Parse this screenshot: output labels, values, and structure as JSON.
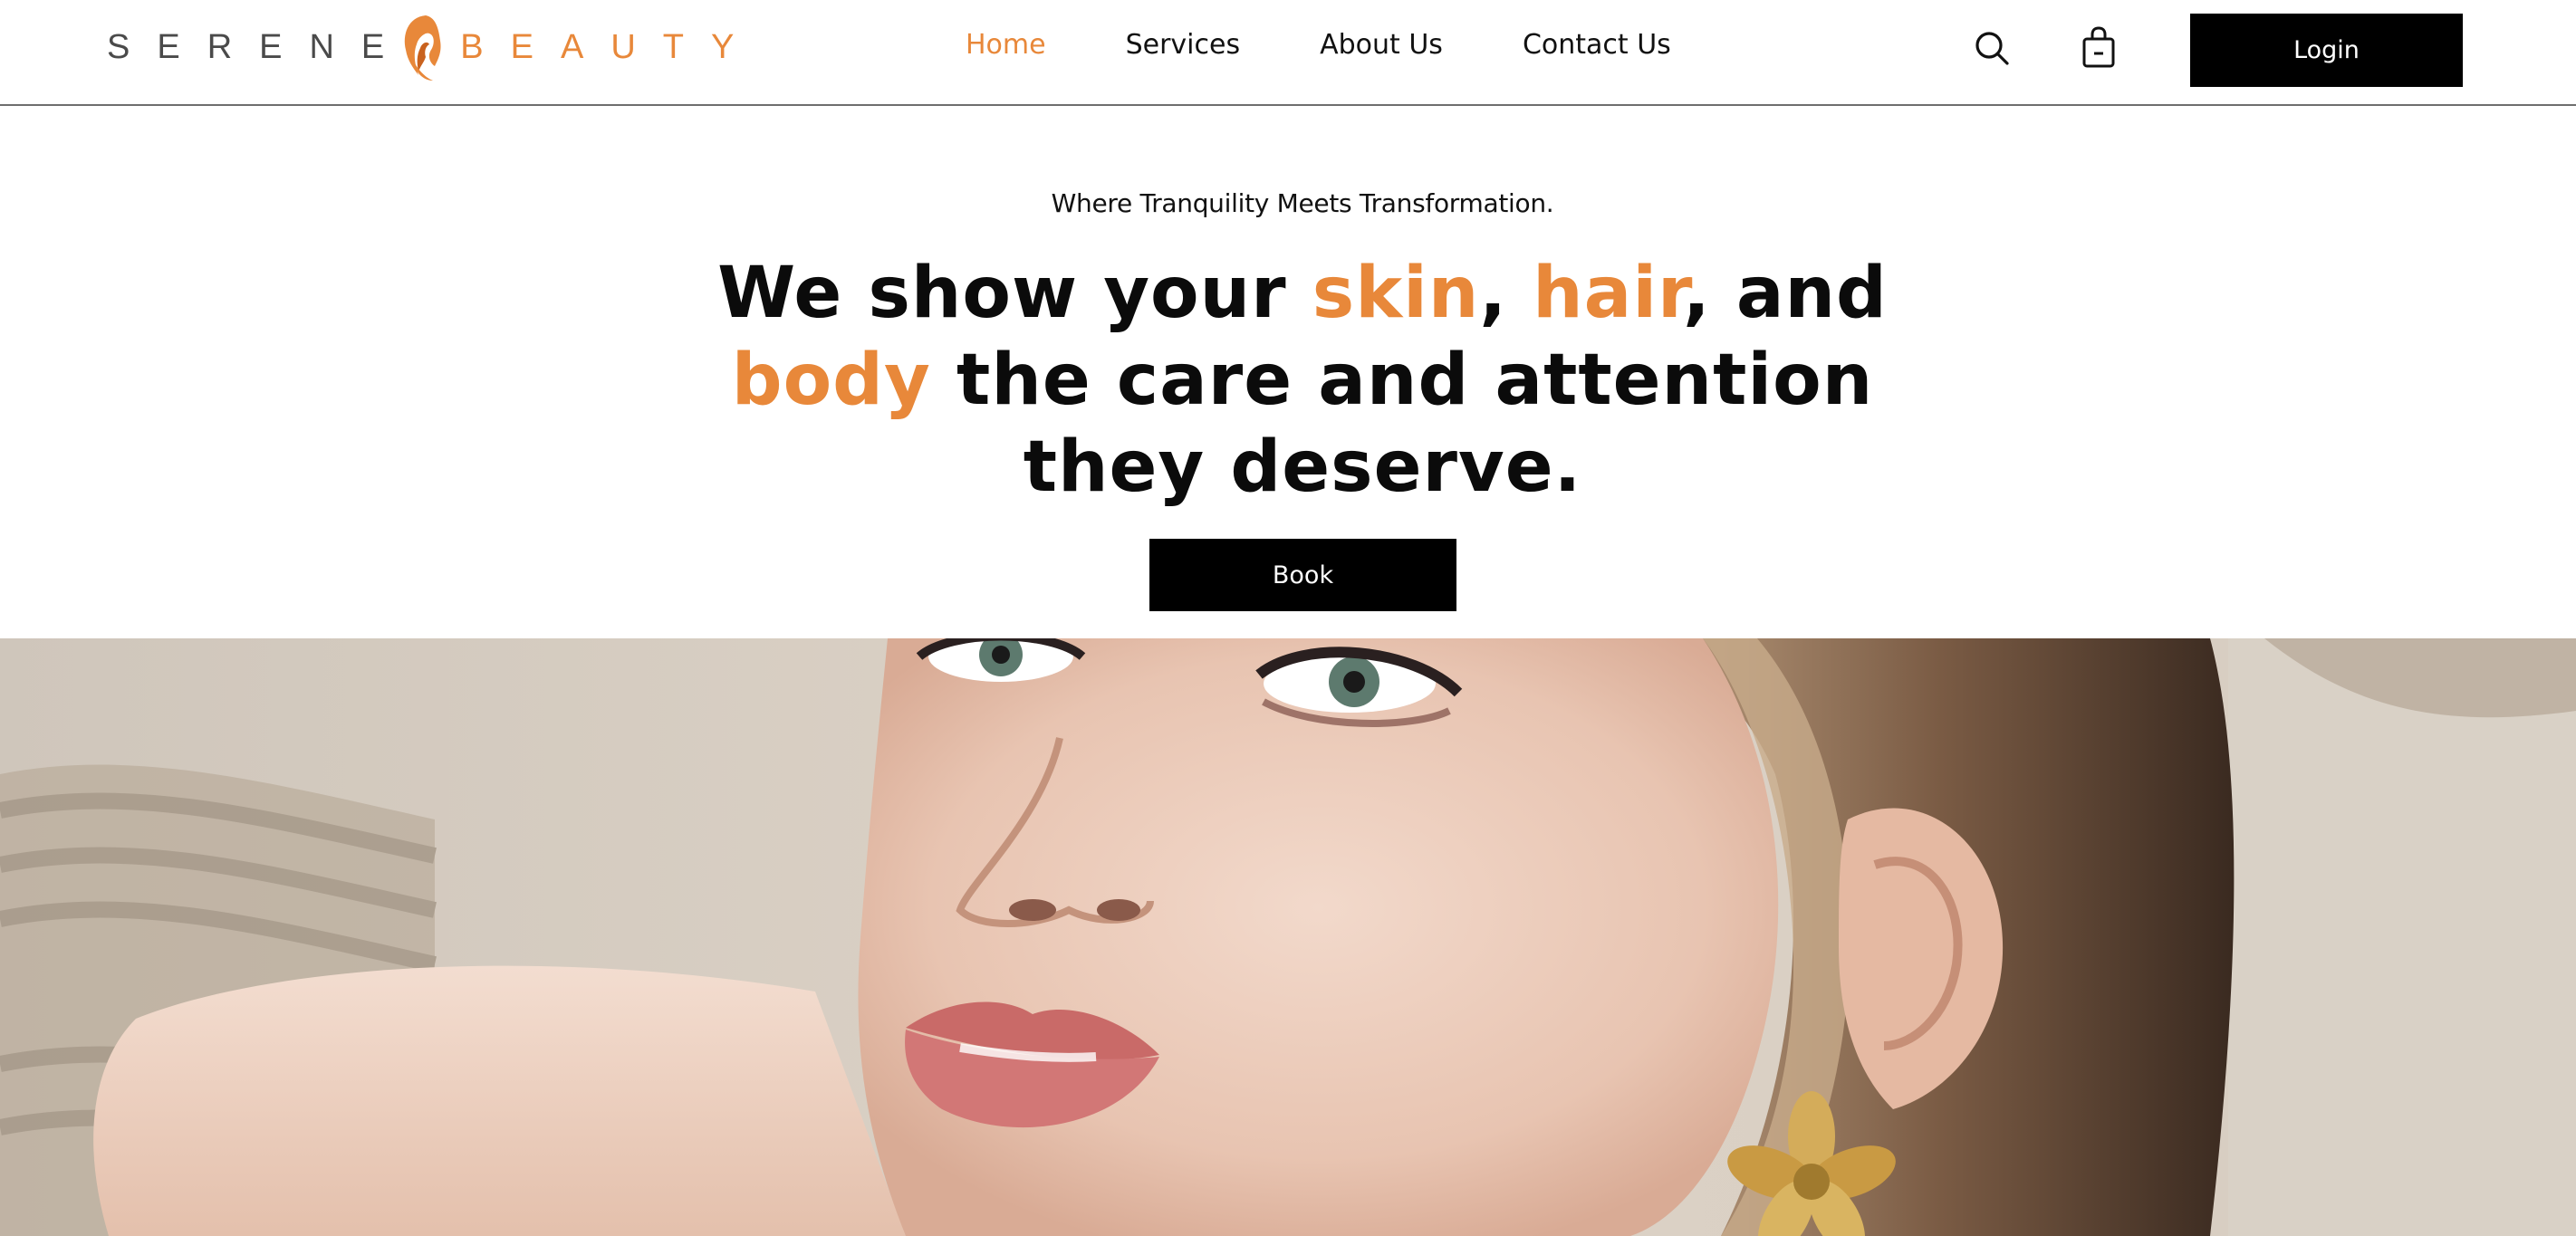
{
  "brand": {
    "name_part1": "SERENE",
    "name_part2": "BEAUTY"
  },
  "nav": {
    "items": [
      {
        "label": "Home",
        "active": true
      },
      {
        "label": "Services",
        "active": false
      },
      {
        "label": "About Us",
        "active": false
      },
      {
        "label": "Contact Us",
        "active": false
      }
    ]
  },
  "header": {
    "search_icon": "search-icon",
    "cart_icon": "shopping-bag-icon",
    "login_label": "Login"
  },
  "hero": {
    "tagline": "Where Tranquility Meets Transformation.",
    "headline": {
      "w1": "We show your ",
      "skin": "skin",
      "comma1": ", ",
      "hair": "hair",
      "w2": ", and",
      "body": "body",
      "w3": " the care and attention",
      "w4": "they deserve."
    },
    "book_label": "Book"
  },
  "colors": {
    "accent": "#e8883a",
    "text": "#0b0b0b",
    "button_bg": "#000000",
    "button_text": "#ffffff"
  }
}
